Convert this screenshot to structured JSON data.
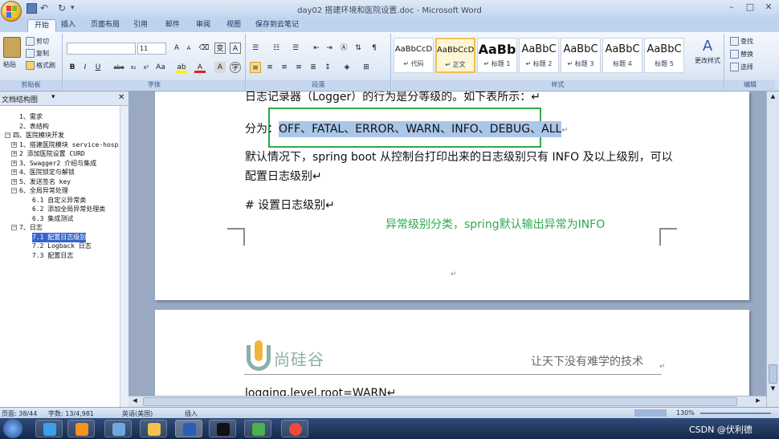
{
  "window": {
    "title": "day02 搭建环境和医院设置.doc - Microsoft Word",
    "minimize": "–",
    "maximize": "□",
    "close": "✕"
  },
  "tabs": [
    "开始",
    "插入",
    "页面布局",
    "引用",
    "邮件",
    "审阅",
    "视图",
    "保存到云笔记"
  ],
  "ribbon": {
    "clipboard": {
      "name": "剪贴板",
      "paste": "粘贴",
      "cut": "剪切",
      "copy": "复制",
      "format_painter": "格式刷"
    },
    "font": {
      "name": "字体",
      "font_name": "",
      "font_size": "11"
    },
    "paragraph": {
      "name": "段落"
    },
    "styles": {
      "name": "样式",
      "items": [
        {
          "sample": "AaBbCcD",
          "label": "↵ 代码"
        },
        {
          "sample": "AaBbCcD",
          "label": "↵ 正文"
        },
        {
          "sample": "AaBb",
          "label": "↵ 标题 1"
        },
        {
          "sample": "AaBbC",
          "label": "↵ 标题 2"
        },
        {
          "sample": "AaBbC",
          "label": "↵ 标题 3"
        },
        {
          "sample": "AaBbC",
          "label": "标题 4"
        },
        {
          "sample": "AaBbC",
          "label": "标题 5"
        }
      ],
      "change_styles": "更改样式"
    },
    "editing": {
      "name": "编辑",
      "find": "查找",
      "replace": "替换",
      "select": "选择"
    }
  },
  "navpane": {
    "title": "文档结构图",
    "items": [
      {
        "text": "1、需求",
        "level": 1,
        "exp": ""
      },
      {
        "text": "2、表结构",
        "level": 1,
        "exp": ""
      },
      {
        "text": "四、医院模块开发",
        "level": 0,
        "exp": "−"
      },
      {
        "text": "1、搭建医院模块 service-hosp",
        "level": 1,
        "exp": "+"
      },
      {
        "text": "2 添加医院设置 CURD",
        "level": 1,
        "exp": "+"
      },
      {
        "text": "3、Swagger2 介绍与集成",
        "level": 1,
        "exp": "+"
      },
      {
        "text": "4、医院锁定与解锁",
        "level": 1,
        "exp": "+"
      },
      {
        "text": "5、发送签名 key",
        "level": 1,
        "exp": "+"
      },
      {
        "text": "6、全局异常处理",
        "level": 1,
        "exp": "−"
      },
      {
        "text": "6.1 自定义异常类",
        "level": 2,
        "exp": ""
      },
      {
        "text": "6.2 添加全局异常处理类",
        "level": 2,
        "exp": ""
      },
      {
        "text": "6.3 集成测试",
        "level": 2,
        "exp": ""
      },
      {
        "text": "7、日志",
        "level": 1,
        "exp": "−"
      },
      {
        "text": "7.1 配置日志级别",
        "level": 2,
        "exp": "",
        "selected": true
      },
      {
        "text": "7.2 Logback 日志",
        "level": 2,
        "exp": ""
      },
      {
        "text": "7.3 配置日志",
        "level": 2,
        "exp": ""
      }
    ]
  },
  "document": {
    "line_top": "日志记录器（Logger）的行为是分等级的。如下表所示：↵",
    "levels_prefix": "分为：",
    "levels": "OFF、FATAL、ERROR、WARN、INFO、DEBUG、ALL",
    "levels_end": "↵",
    "default_line1": "默认情况下，spring boot 从控制台打印出来的日志级别只有 INFO 及以上级别，可以",
    "default_line2": "配置日志级别↵",
    "comment": "# 设置日志级别↵",
    "annotation": "异常级别分类，spring默认输出异常为INFO",
    "para_mark": "↵",
    "logo_text": "尚硅谷",
    "slogan": "让天下没有难学的技术",
    "slogan_mark": "↵",
    "config_key": "logging.level.root",
    "config_val": "=WARN↵"
  },
  "colors": {
    "highlight": "#aac6e8",
    "annotation": "#2fa84f",
    "annotation_box": "#2fa84f"
  },
  "statusbar": {
    "page": "页面: 38/44",
    "words": "字数: 13/4,981",
    "language": "英语(美国)",
    "insert": "插入",
    "zoom": "130%"
  },
  "watermark": "CSDN @伏利德"
}
